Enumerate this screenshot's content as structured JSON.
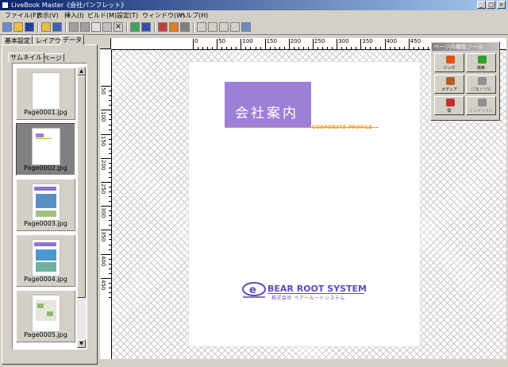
{
  "window": {
    "title": "LiveBook Master《会社パンフレット》",
    "min": "_",
    "max": "□",
    "close": "×"
  },
  "menu": [
    "ファイル(F)",
    "表示(V)",
    "挿入(I)",
    "ビルド(M)",
    "設定(T)",
    "ウィンドウ(W)",
    "ヘルプ(H)"
  ],
  "panel_tabs": [
    "基本設定",
    "レイアウト",
    "データ"
  ],
  "sub_tabs": [
    "サムネイル",
    "ページ"
  ],
  "thumbnails": [
    {
      "label": "Page0001.jpg",
      "selected": false
    },
    {
      "label": "Page0002.jpg",
      "selected": true
    },
    {
      "label": "Page0003.jpg",
      "selected": false
    },
    {
      "label": "Page0004.jpg",
      "selected": false
    },
    {
      "label": "Page0005.jpg",
      "selected": false
    }
  ],
  "ruler_top": [
    "0",
    "50",
    "100",
    "150",
    "200",
    "250",
    "300",
    "350",
    "400",
    "450"
  ],
  "ruler_left": [
    "50",
    "100",
    "150",
    "200",
    "250",
    "300",
    "350",
    "400",
    "450"
  ],
  "page": {
    "title": "会社案内",
    "subtitle": "CORPORATE PROFILE",
    "logo_name": "BEAR ROOT SYSTEM",
    "logo_sub": "株式会社 ベアールートシステム",
    "accent_color": "#9d7fd6",
    "rule_color": "#f0a020"
  },
  "palette": {
    "title": "ページ内機能ツール",
    "buttons": [
      {
        "label": "リンク",
        "icon": "link-icon",
        "color": "#e05010"
      },
      {
        "label": "検索",
        "icon": "search-icon",
        "color": "#30a030"
      },
      {
        "label": "メディア",
        "icon": "media-icon",
        "color": "#b06020"
      },
      {
        "label": "付箋メモ帳",
        "icon": "memo-icon",
        "color": "#909090"
      },
      {
        "label": "栞",
        "icon": "bookmark-icon",
        "color": "#c03030"
      },
      {
        "label": "インデックス",
        "icon": "index-icon",
        "color": "#909090"
      }
    ]
  }
}
